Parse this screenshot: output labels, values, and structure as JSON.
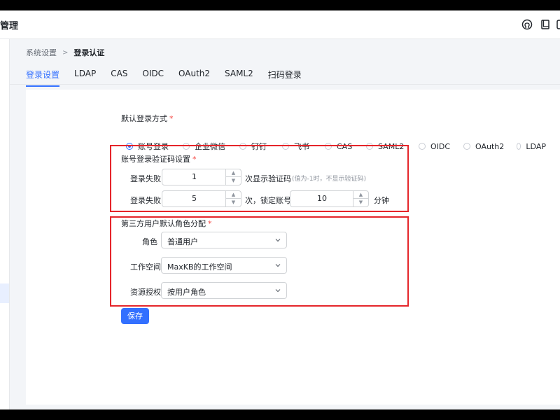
{
  "header": {
    "app_title": "管理",
    "icons": [
      "github-icon",
      "book-icon",
      "more-icon"
    ]
  },
  "breadcrumb": {
    "parent": "系统设置",
    "separator": ">",
    "current": "登录认证"
  },
  "tabs": [
    {
      "label": "登录设置",
      "active": true
    },
    {
      "label": "LDAP",
      "active": false
    },
    {
      "label": "CAS",
      "active": false
    },
    {
      "label": "OIDC",
      "active": false
    },
    {
      "label": "OAuth2",
      "active": false
    },
    {
      "label": "SAML2",
      "active": false
    },
    {
      "label": "扫码登录",
      "active": false
    }
  ],
  "default_login": {
    "label": "默认登录方式",
    "required_mark": "*",
    "options": [
      {
        "label": "账号登录",
        "checked": true
      },
      {
        "label": "企业微信",
        "checked": false
      },
      {
        "label": "钉钉",
        "checked": false
      },
      {
        "label": "飞书",
        "checked": false
      },
      {
        "label": "CAS",
        "checked": false
      },
      {
        "label": "SAML2",
        "checked": false
      },
      {
        "label": "OIDC",
        "checked": false
      },
      {
        "label": "OAuth2",
        "checked": false
      },
      {
        "label": "LDAP",
        "checked": false
      }
    ]
  },
  "captcha": {
    "label": "账号登录验证码设置",
    "required_mark": "*",
    "row1": {
      "label": "登录失败",
      "value": "1",
      "suffix": "次显示验证码",
      "hint": "(值为-1时，不显示验证码)"
    },
    "row2": {
      "label": "登录失败",
      "value": "5",
      "suffix": "次，锁定账号",
      "lock_value": "10",
      "lock_unit": "分钟"
    }
  },
  "role_assign": {
    "label": "第三方用户默认角色分配",
    "required_mark": "*",
    "role": {
      "label": "角色",
      "value": "普通用户"
    },
    "workspace": {
      "label": "工作空间",
      "value": "MaxKB的工作空间"
    },
    "resource": {
      "label": "资源授权",
      "value": "按用户角色"
    }
  },
  "save_label": "保存",
  "colors": {
    "primary": "#3370ff",
    "highlight": "#e5252a",
    "required": "#f54a45"
  }
}
